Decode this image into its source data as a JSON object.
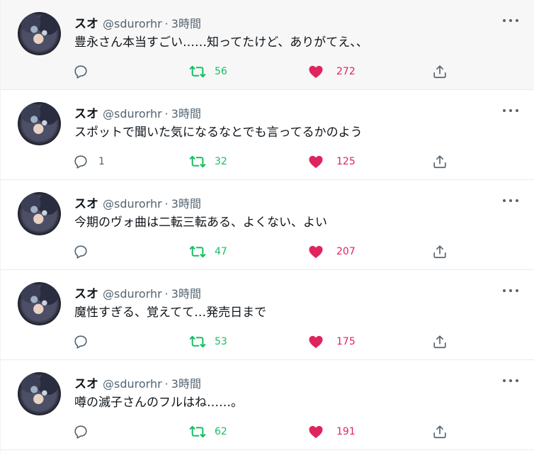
{
  "colors": {
    "handle": "#536471",
    "retweet": "#17bf63",
    "like": "#e0245e",
    "icon": "#536471"
  },
  "icons": {
    "reply": "reply-icon",
    "retweet": "retweet-icon",
    "like": "heart-icon",
    "share": "share-icon",
    "more": "more-icon"
  },
  "tweets": [
    {
      "name": "スオ",
      "handle": "@sdurorhr",
      "separator": "·",
      "time": "3時間",
      "text": "豊永さん本当すごい……知ってたけど、ありがてえ、、",
      "replies": "",
      "retweets": "56",
      "likes": "272"
    },
    {
      "name": "スオ",
      "handle": "@sdurorhr",
      "separator": "·",
      "time": "3時間",
      "text": "スポットで聞いた気になるなとでも言ってるかのよう",
      "replies": "1",
      "retweets": "32",
      "likes": "125"
    },
    {
      "name": "スオ",
      "handle": "@sdurorhr",
      "separator": "·",
      "time": "3時間",
      "text": "今期のヴォ曲は二転三転ある、よくない、よい",
      "replies": "",
      "retweets": "47",
      "likes": "207"
    },
    {
      "name": "スオ",
      "handle": "@sdurorhr",
      "separator": "·",
      "time": "3時間",
      "text": "魔性すぎる、覚えてて…発売日まで",
      "replies": "",
      "retweets": "53",
      "likes": "175"
    },
    {
      "name": "スオ",
      "handle": "@sdurorhr",
      "separator": "·",
      "time": "3時間",
      "text": "噂の滅子さんのフルはね……。",
      "replies": "",
      "retweets": "62",
      "likes": "191"
    }
  ]
}
